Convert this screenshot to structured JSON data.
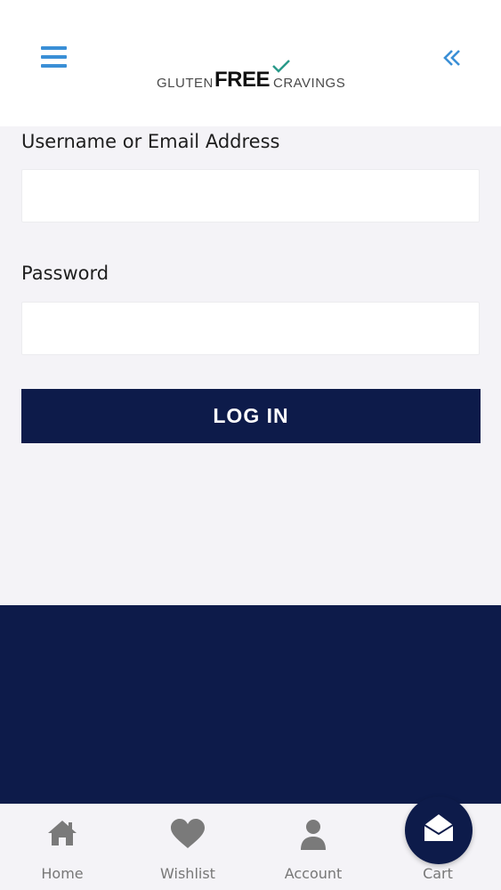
{
  "header": {
    "logo": {
      "word1": "GLUTEN",
      "word2": "FREE",
      "word3": "CRAVINGS"
    },
    "menu_icon": "hamburger-menu-icon",
    "collapse_icon": "double-chevron-left-icon"
  },
  "login_form": {
    "username_label": "Username or Email Address",
    "username_value": "",
    "password_label": "Password",
    "password_value": "",
    "submit_label": "LOG IN"
  },
  "bottom_nav": {
    "items": [
      {
        "label": "Home",
        "icon": "home-icon"
      },
      {
        "label": "Wishlist",
        "icon": "heart-icon"
      },
      {
        "label": "Account",
        "icon": "user-icon"
      },
      {
        "label": "Cart",
        "icon": "cart-icon"
      }
    ]
  },
  "fab": {
    "icon": "envelope-open-icon"
  },
  "colors": {
    "accent": "#3a8fd6",
    "navy": "#0d1b4a",
    "background": "#f4f3f7",
    "nav_icon": "#7a7a7a"
  }
}
